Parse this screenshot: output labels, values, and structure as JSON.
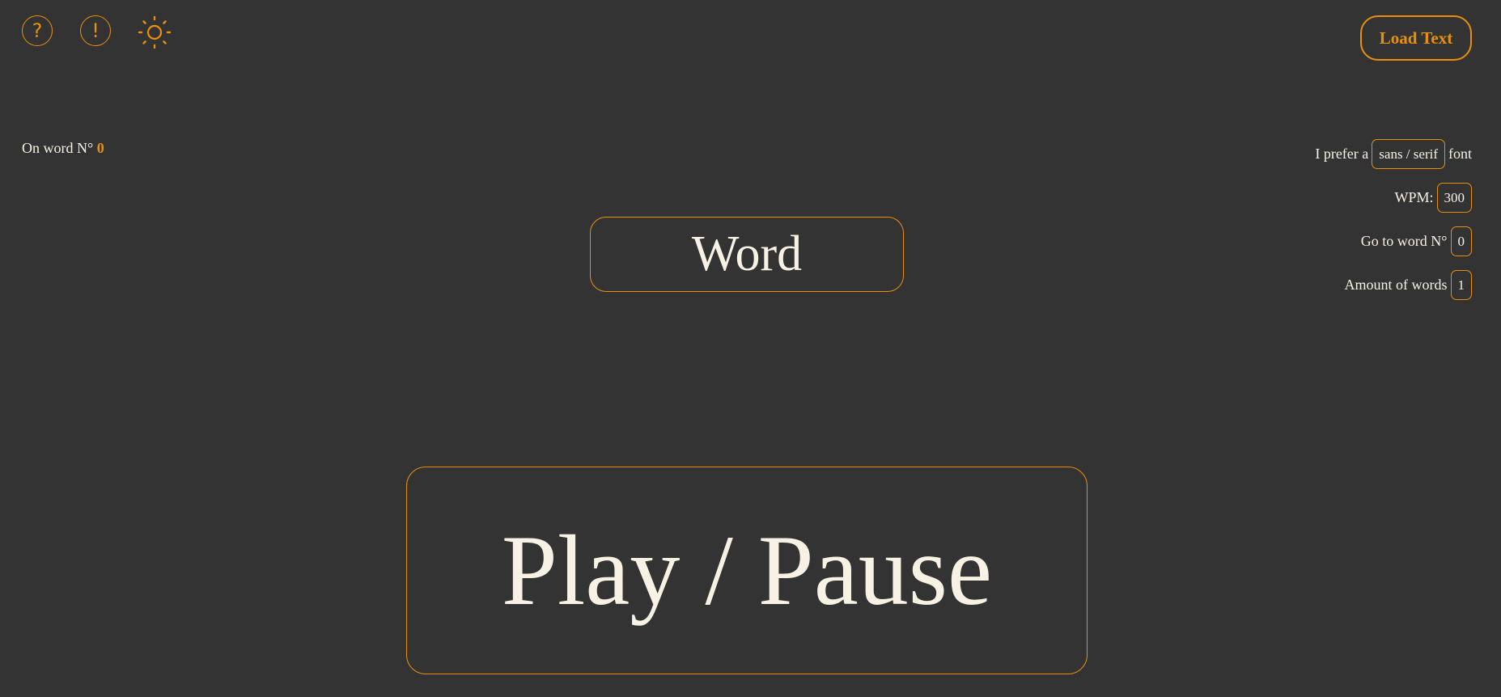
{
  "toolbar": {
    "help_icon": "?",
    "info_icon": "!",
    "theme_icon": "sun-icon",
    "load_text_label": "Load Text"
  },
  "counter": {
    "label": "On word N°",
    "value": "0"
  },
  "settings": {
    "font": {
      "prefix": "I prefer a",
      "value": "sans / serif",
      "suffix": "font"
    },
    "wpm": {
      "label": "WPM:",
      "value": "300"
    },
    "goto": {
      "label": "Go to word N°",
      "value": "0"
    },
    "amount": {
      "label": "Amount of words",
      "value": "1"
    }
  },
  "reader": {
    "word": "Word",
    "play_pause_label": "Play / Pause"
  },
  "colors": {
    "background": "#333333",
    "accent": "#e8900c",
    "text": "#f8f2e4"
  }
}
